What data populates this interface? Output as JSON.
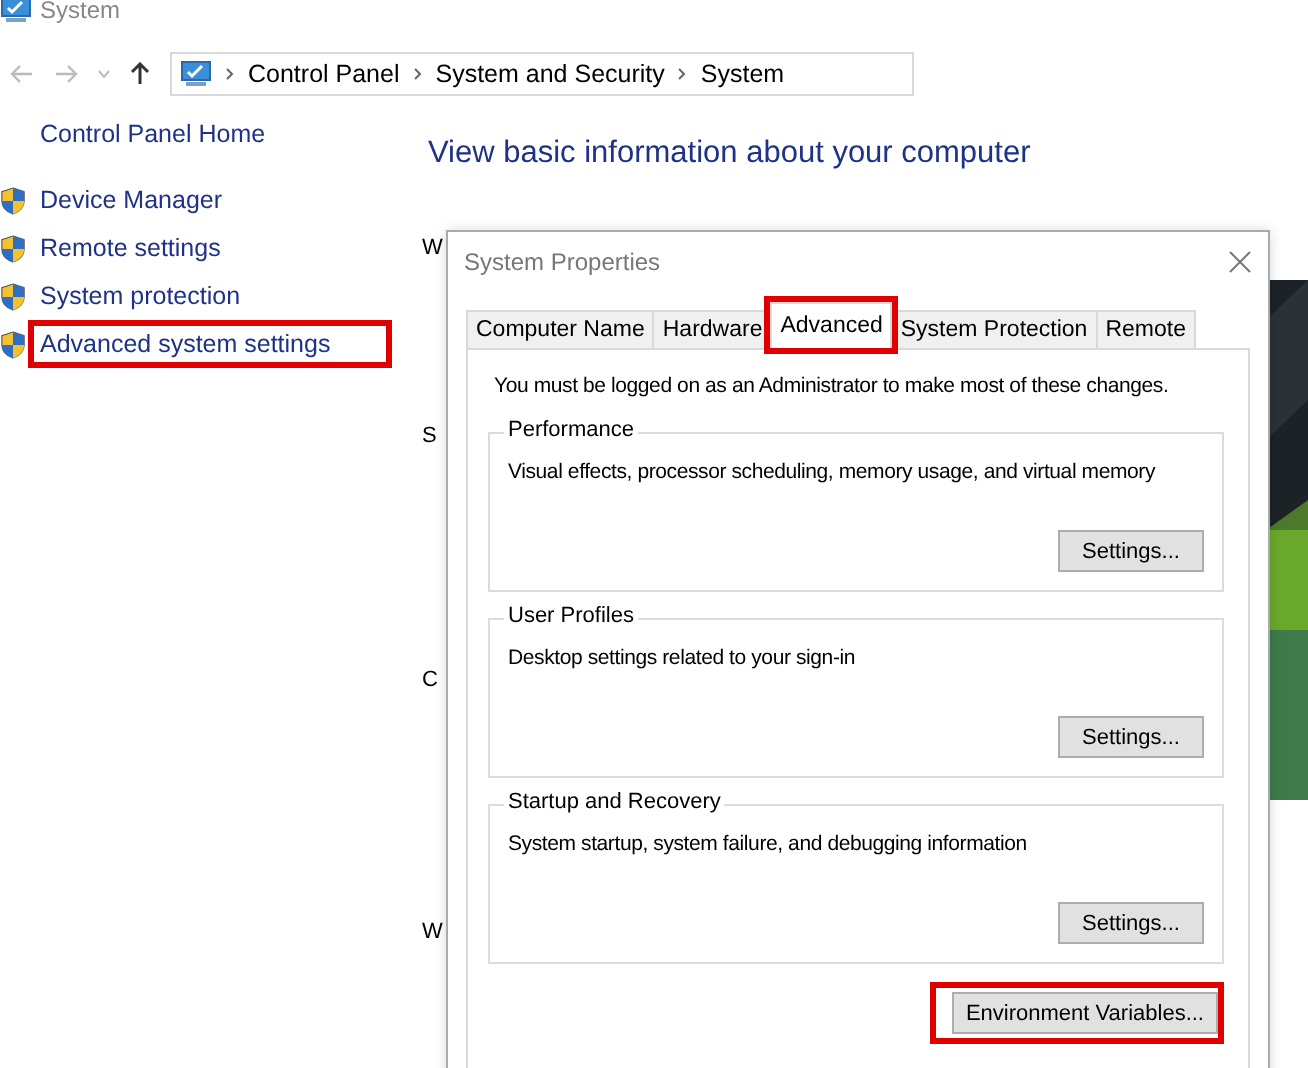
{
  "window": {
    "title": "System"
  },
  "breadcrumb": [
    "Control Panel",
    "System and Security",
    "System"
  ],
  "sidebar": {
    "home": "Control Panel Home",
    "items": [
      {
        "label": "Device Manager",
        "highlighted": false
      },
      {
        "label": "Remote settings",
        "highlighted": false
      },
      {
        "label": "System protection",
        "highlighted": false
      },
      {
        "label": "Advanced system settings",
        "highlighted": true
      }
    ]
  },
  "main": {
    "heading": "View basic information about your computer",
    "partial_labels": [
      "W",
      "S",
      "C",
      "W"
    ]
  },
  "background_image": {
    "kind": "picture"
  },
  "dialog": {
    "title": "System Properties",
    "tabs": [
      {
        "label": "Computer Name",
        "selected": false,
        "highlighted": false
      },
      {
        "label": "Hardware",
        "selected": false,
        "highlighted": false
      },
      {
        "label": "Advanced",
        "selected": true,
        "highlighted": true
      },
      {
        "label": "System Protection",
        "selected": false,
        "highlighted": false
      },
      {
        "label": "Remote",
        "selected": false,
        "highlighted": false
      }
    ],
    "notice": "You must be logged on as an Administrator to make most of these changes.",
    "groups": [
      {
        "title": "Performance",
        "description": "Visual effects, processor scheduling, memory usage, and virtual memory",
        "button": "Settings..."
      },
      {
        "title": "User Profiles",
        "description": "Desktop settings related to your sign-in",
        "button": "Settings..."
      },
      {
        "title": "Startup and Recovery",
        "description": "System startup, system failure, and debugging information",
        "button": "Settings..."
      }
    ],
    "footer_button": {
      "label": "Environment Variables...",
      "highlighted": true
    }
  }
}
